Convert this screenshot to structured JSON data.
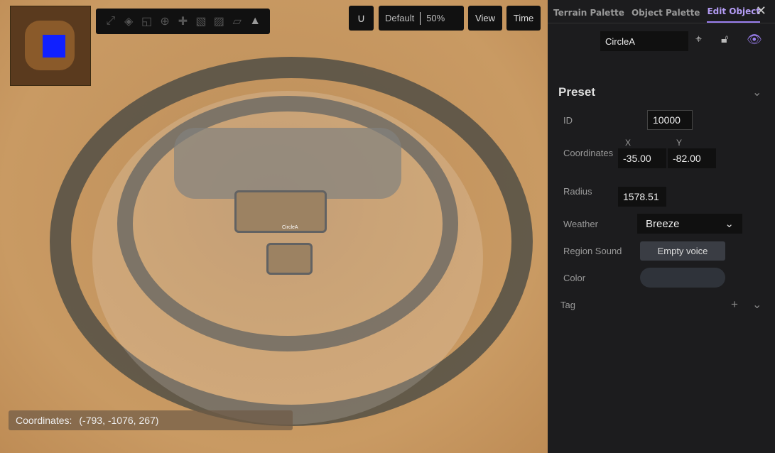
{
  "toolbar": {
    "icons": [
      "fit-icon",
      "rotate-icon",
      "layer-icon",
      "target-icon",
      "puzzle-icon",
      "copy-layer-icon",
      "paste-layer-icon",
      "ruler-icon",
      "terrain-icon"
    ],
    "snap_icon": "magnet-icon",
    "preset": "Default",
    "zoom": "50%",
    "view_label": "View",
    "time_label": "Time"
  },
  "viewport": {
    "object_label": "CircleA",
    "coordinates_label": "Coordinates:",
    "coordinates_value": "(-793, -1076, 267)"
  },
  "panel": {
    "tabs": [
      "Terrain Palette",
      "Object Palette",
      "Edit Object"
    ],
    "active_tab": "Edit Object",
    "name": "CircleA",
    "section": "Preset",
    "id_label": "ID",
    "id": "10000",
    "coords_label": "Coordinates",
    "x_label": "X",
    "y_label": "Y",
    "x": "-35.00",
    "y": "-82.00",
    "radius_label": "Radius",
    "radius": "1578.51",
    "weather_label": "Weather",
    "weather": "Breeze",
    "sound_label": "Region Sound",
    "sound": "Empty voice",
    "color_label": "Color",
    "tag_label": "Tag",
    "accent": "#9b7ff0"
  }
}
